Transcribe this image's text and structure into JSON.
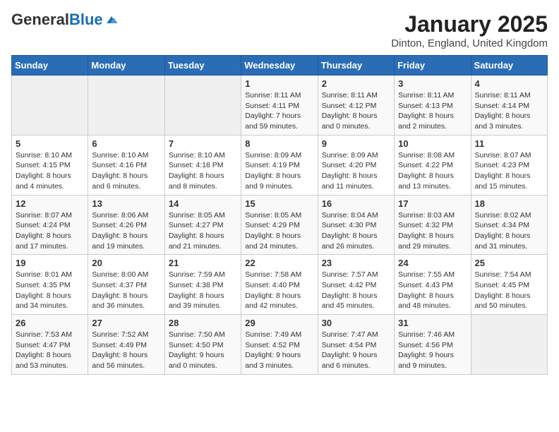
{
  "logo": {
    "general": "General",
    "blue": "Blue"
  },
  "title": "January 2025",
  "location": "Dinton, England, United Kingdom",
  "days_header": [
    "Sunday",
    "Monday",
    "Tuesday",
    "Wednesday",
    "Thursday",
    "Friday",
    "Saturday"
  ],
  "weeks": [
    [
      {
        "day": "",
        "info": ""
      },
      {
        "day": "",
        "info": ""
      },
      {
        "day": "",
        "info": ""
      },
      {
        "day": "1",
        "info": "Sunrise: 8:11 AM\nSunset: 4:11 PM\nDaylight: 7 hours and 59 minutes."
      },
      {
        "day": "2",
        "info": "Sunrise: 8:11 AM\nSunset: 4:12 PM\nDaylight: 8 hours and 0 minutes."
      },
      {
        "day": "3",
        "info": "Sunrise: 8:11 AM\nSunset: 4:13 PM\nDaylight: 8 hours and 2 minutes."
      },
      {
        "day": "4",
        "info": "Sunrise: 8:11 AM\nSunset: 4:14 PM\nDaylight: 8 hours and 3 minutes."
      }
    ],
    [
      {
        "day": "5",
        "info": "Sunrise: 8:10 AM\nSunset: 4:15 PM\nDaylight: 8 hours and 4 minutes."
      },
      {
        "day": "6",
        "info": "Sunrise: 8:10 AM\nSunset: 4:16 PM\nDaylight: 8 hours and 6 minutes."
      },
      {
        "day": "7",
        "info": "Sunrise: 8:10 AM\nSunset: 4:18 PM\nDaylight: 8 hours and 8 minutes."
      },
      {
        "day": "8",
        "info": "Sunrise: 8:09 AM\nSunset: 4:19 PM\nDaylight: 8 hours and 9 minutes."
      },
      {
        "day": "9",
        "info": "Sunrise: 8:09 AM\nSunset: 4:20 PM\nDaylight: 8 hours and 11 minutes."
      },
      {
        "day": "10",
        "info": "Sunrise: 8:08 AM\nSunset: 4:22 PM\nDaylight: 8 hours and 13 minutes."
      },
      {
        "day": "11",
        "info": "Sunrise: 8:07 AM\nSunset: 4:23 PM\nDaylight: 8 hours and 15 minutes."
      }
    ],
    [
      {
        "day": "12",
        "info": "Sunrise: 8:07 AM\nSunset: 4:24 PM\nDaylight: 8 hours and 17 minutes."
      },
      {
        "day": "13",
        "info": "Sunrise: 8:06 AM\nSunset: 4:26 PM\nDaylight: 8 hours and 19 minutes."
      },
      {
        "day": "14",
        "info": "Sunrise: 8:05 AM\nSunset: 4:27 PM\nDaylight: 8 hours and 21 minutes."
      },
      {
        "day": "15",
        "info": "Sunrise: 8:05 AM\nSunset: 4:29 PM\nDaylight: 8 hours and 24 minutes."
      },
      {
        "day": "16",
        "info": "Sunrise: 8:04 AM\nSunset: 4:30 PM\nDaylight: 8 hours and 26 minutes."
      },
      {
        "day": "17",
        "info": "Sunrise: 8:03 AM\nSunset: 4:32 PM\nDaylight: 8 hours and 29 minutes."
      },
      {
        "day": "18",
        "info": "Sunrise: 8:02 AM\nSunset: 4:34 PM\nDaylight: 8 hours and 31 minutes."
      }
    ],
    [
      {
        "day": "19",
        "info": "Sunrise: 8:01 AM\nSunset: 4:35 PM\nDaylight: 8 hours and 34 minutes."
      },
      {
        "day": "20",
        "info": "Sunrise: 8:00 AM\nSunset: 4:37 PM\nDaylight: 8 hours and 36 minutes."
      },
      {
        "day": "21",
        "info": "Sunrise: 7:59 AM\nSunset: 4:38 PM\nDaylight: 8 hours and 39 minutes."
      },
      {
        "day": "22",
        "info": "Sunrise: 7:58 AM\nSunset: 4:40 PM\nDaylight: 8 hours and 42 minutes."
      },
      {
        "day": "23",
        "info": "Sunrise: 7:57 AM\nSunset: 4:42 PM\nDaylight: 8 hours and 45 minutes."
      },
      {
        "day": "24",
        "info": "Sunrise: 7:55 AM\nSunset: 4:43 PM\nDaylight: 8 hours and 48 minutes."
      },
      {
        "day": "25",
        "info": "Sunrise: 7:54 AM\nSunset: 4:45 PM\nDaylight: 8 hours and 50 minutes."
      }
    ],
    [
      {
        "day": "26",
        "info": "Sunrise: 7:53 AM\nSunset: 4:47 PM\nDaylight: 8 hours and 53 minutes."
      },
      {
        "day": "27",
        "info": "Sunrise: 7:52 AM\nSunset: 4:49 PM\nDaylight: 8 hours and 56 minutes."
      },
      {
        "day": "28",
        "info": "Sunrise: 7:50 AM\nSunset: 4:50 PM\nDaylight: 9 hours and 0 minutes."
      },
      {
        "day": "29",
        "info": "Sunrise: 7:49 AM\nSunset: 4:52 PM\nDaylight: 9 hours and 3 minutes."
      },
      {
        "day": "30",
        "info": "Sunrise: 7:47 AM\nSunset: 4:54 PM\nDaylight: 9 hours and 6 minutes."
      },
      {
        "day": "31",
        "info": "Sunrise: 7:46 AM\nSunset: 4:56 PM\nDaylight: 9 hours and 9 minutes."
      },
      {
        "day": "",
        "info": ""
      }
    ]
  ]
}
